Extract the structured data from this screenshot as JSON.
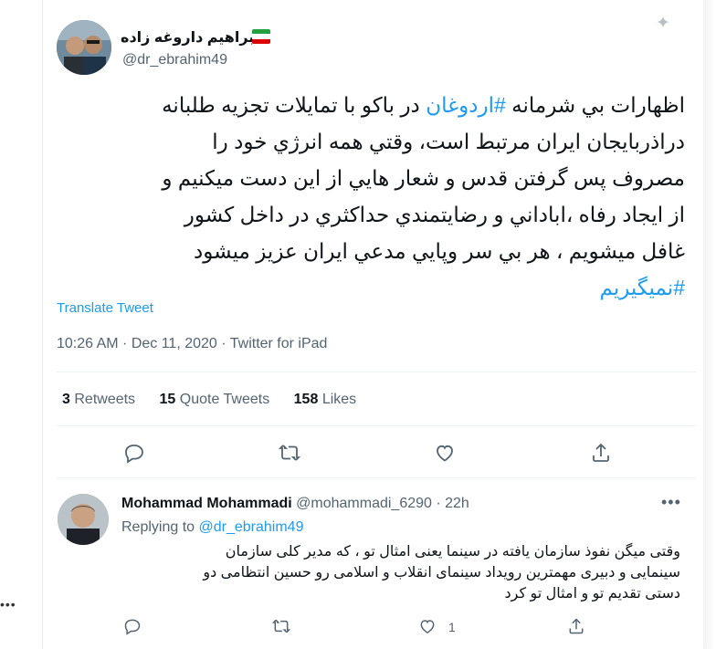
{
  "colors": {
    "accent": "#1d9bf0",
    "secondary_text": "#536471",
    "primary_text": "#0f1419"
  },
  "tweet": {
    "display_name": "ابراهیم داروغه زاده",
    "handle": "@dr_ebrahim49",
    "lines": [
      {
        "pre": "اظهارات بي شرمانه ",
        "tag": "#اردوغان",
        "post": " در باكو با تمايلات تجزيه طلبانه"
      },
      {
        "pre": "دراذربايجان ايران مرتبط است، وقتي همه انرژي خود را"
      },
      {
        "pre": "مصروف پس گرفتن قدس و شعار هايي از اين دست ميكنيم و"
      },
      {
        "pre": "از ايجاد رفاه ،اباداني و رضايتمندي حداكثري در داخل كشور"
      },
      {
        "pre": "غافل ميشويم ، هر بي سر وپايي مدعي ايران عزيز ميشود"
      }
    ],
    "final_hashtag": "#نميگيريم",
    "translate_label": "Translate Tweet",
    "timestamp": "10:26 AM · Dec 11, 2020 · Twitter for iPad",
    "stats": {
      "retweets_count": "3",
      "retweets_label": "Retweets",
      "quotes_count": "15",
      "quotes_label": "Quote Tweets",
      "likes_count": "158",
      "likes_label": "Likes"
    }
  },
  "reply": {
    "name": "Mohammad Mohammadi",
    "handle": "@mohammadi_6290",
    "time": "· 22h",
    "replying_prefix": "Replying to",
    "replying_to": "@dr_ebrahim49",
    "body_lines": [
      "وقتی میگن نفوذ سازمان یافته در سینما یعنی امثال تو ، که مدیر کلی سازمان",
      "سینمایی و دبیری مهمترین رویداد سینمای انقلاب و اسلامی رو حسین انتظامی دو",
      "دستی تقدیم تو و امثال تو کرد"
    ],
    "like_count": "1"
  },
  "icons": {
    "reply": "reply-icon",
    "retweet": "retweet-icon",
    "like": "heart-icon",
    "share": "share-icon",
    "more": "more-icon",
    "flag": "iran-flag-icon"
  }
}
